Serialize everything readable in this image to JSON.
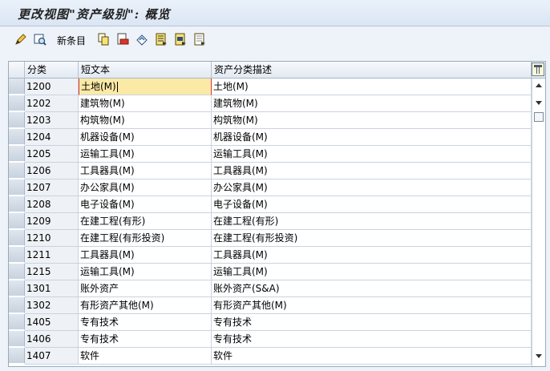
{
  "window": {
    "title": "更改视图\"资产级别\": 概览"
  },
  "toolbar": {
    "new_entries_label": "新条目",
    "icons": [
      "edit-icon",
      "display-change-icon",
      "copy-icon",
      "delete-icon",
      "undo-icon",
      "select-all-icon",
      "select-block-icon",
      "deselect-all-icon"
    ]
  },
  "table": {
    "headers": {
      "asset_class": "分类",
      "short_text": "短文本",
      "description": "资产分类描述"
    },
    "rows": [
      {
        "asset_class": "1200",
        "short_text": "土地(M)",
        "description": "土地(M)"
      },
      {
        "asset_class": "1202",
        "short_text": "建筑物(M)",
        "description": "建筑物(M)"
      },
      {
        "asset_class": "1203",
        "short_text": "构筑物(M)",
        "description": "构筑物(M)"
      },
      {
        "asset_class": "1204",
        "short_text": "机器设备(M)",
        "description": "机器设备(M)"
      },
      {
        "asset_class": "1205",
        "short_text": "运输工具(M)",
        "description": "运输工具(M)"
      },
      {
        "asset_class": "1206",
        "short_text": "工具器具(M)",
        "description": "工具器具(M)"
      },
      {
        "asset_class": "1207",
        "short_text": "办公家具(M)",
        "description": "办公家具(M)"
      },
      {
        "asset_class": "1208",
        "short_text": "电子设备(M)",
        "description": "电子设备(M)"
      },
      {
        "asset_class": "1209",
        "short_text": "在建工程(有形)",
        "description": "在建工程(有形)"
      },
      {
        "asset_class": "1210",
        "short_text": "在建工程(有形投资)",
        "description": "在建工程(有形投资)"
      },
      {
        "asset_class": "1211",
        "short_text": "工具器具(M)",
        "description": "工具器具(M)"
      },
      {
        "asset_class": "1215",
        "short_text": "运输工具(M)",
        "description": "运输工具(M)"
      },
      {
        "asset_class": "1301",
        "short_text": "账外资产",
        "description": "账外资产(S&A)"
      },
      {
        "asset_class": "1302",
        "short_text": "有形资产其他(M)",
        "description": "有形资产其他(M)"
      },
      {
        "asset_class": "1405",
        "short_text": "专有技术",
        "description": "专有技术"
      },
      {
        "asset_class": "1406",
        "short_text": "专有技术",
        "description": "专有技术"
      },
      {
        "asset_class": "1407",
        "short_text": "软件",
        "description": "软件"
      }
    ]
  },
  "colors": {
    "active_cell": "#fbe9a6",
    "header_bg": "#e2e9f2",
    "window_bg": "#eef3f9"
  }
}
